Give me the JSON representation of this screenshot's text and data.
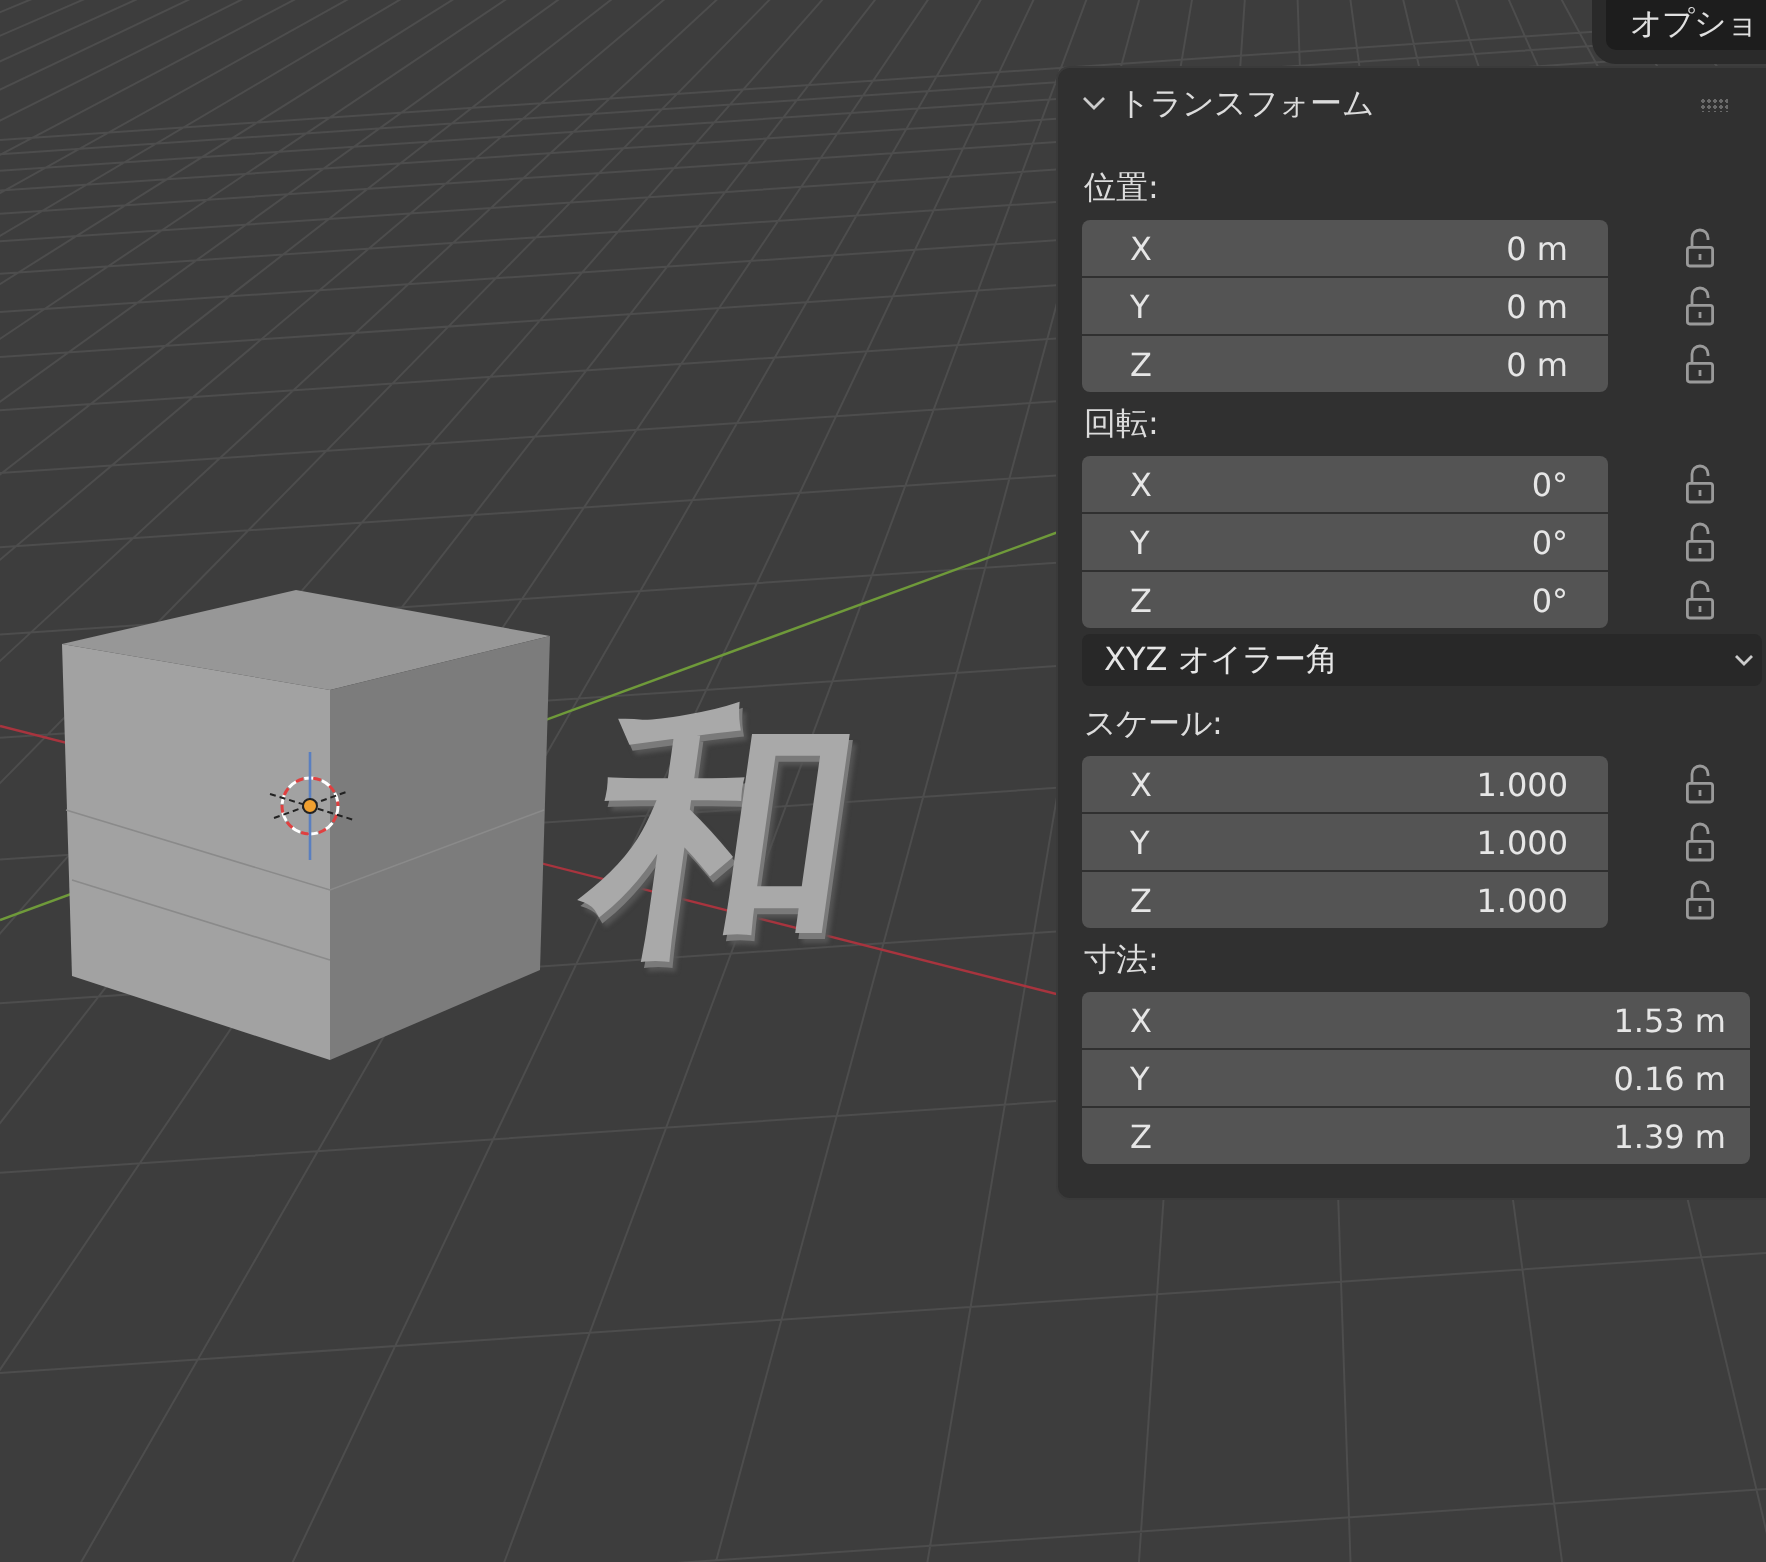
{
  "options_button": {
    "label": "オプショ"
  },
  "viewport": {
    "text_object": "和"
  },
  "panel": {
    "title": "トランスフォーム",
    "expanded": true,
    "sections": [
      {
        "label": "位置:",
        "fields": [
          {
            "axis": "X",
            "value": "0 m",
            "locked": false
          },
          {
            "axis": "Y",
            "value": "0 m",
            "locked": false
          },
          {
            "axis": "Z",
            "value": "0 m",
            "locked": false
          }
        ]
      },
      {
        "label": "回転:",
        "fields": [
          {
            "axis": "X",
            "value": "0°",
            "locked": false
          },
          {
            "axis": "Y",
            "value": "0°",
            "locked": false
          },
          {
            "axis": "Z",
            "value": "0°",
            "locked": false
          }
        ],
        "dropdown": "XYZ オイラー角"
      },
      {
        "label": "スケール:",
        "fields": [
          {
            "axis": "X",
            "value": "1.000",
            "locked": false
          },
          {
            "axis": "Y",
            "value": "1.000",
            "locked": false
          },
          {
            "axis": "Z",
            "value": "1.000",
            "locked": false
          }
        ]
      },
      {
        "label": "寸法:",
        "fields": [
          {
            "axis": "X",
            "value": "1.53 m"
          },
          {
            "axis": "Y",
            "value": "0.16 m"
          },
          {
            "axis": "Z",
            "value": "1.39 m"
          }
        ]
      }
    ]
  }
}
